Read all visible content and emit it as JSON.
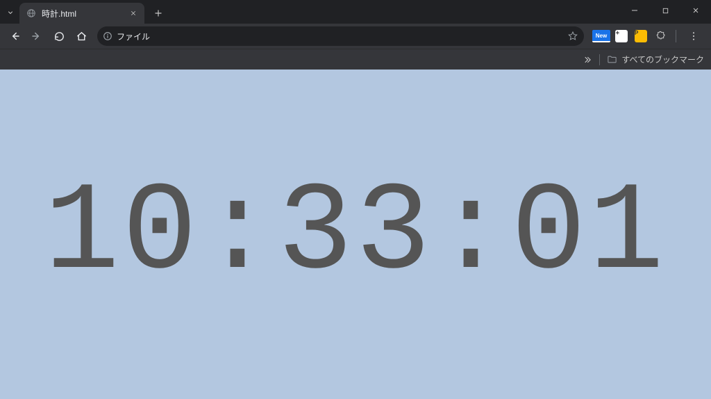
{
  "tab": {
    "title": "時計.html",
    "favicon_name": "globe-icon"
  },
  "omnibox": {
    "url_label": "ファイル"
  },
  "extensions": {
    "new_label": "New"
  },
  "bookmarks": {
    "all_label": "すべてのブックマーク"
  },
  "page": {
    "clock_time": "10:33:01",
    "bg_color": "#b3c7e0",
    "text_color": "#555555"
  }
}
